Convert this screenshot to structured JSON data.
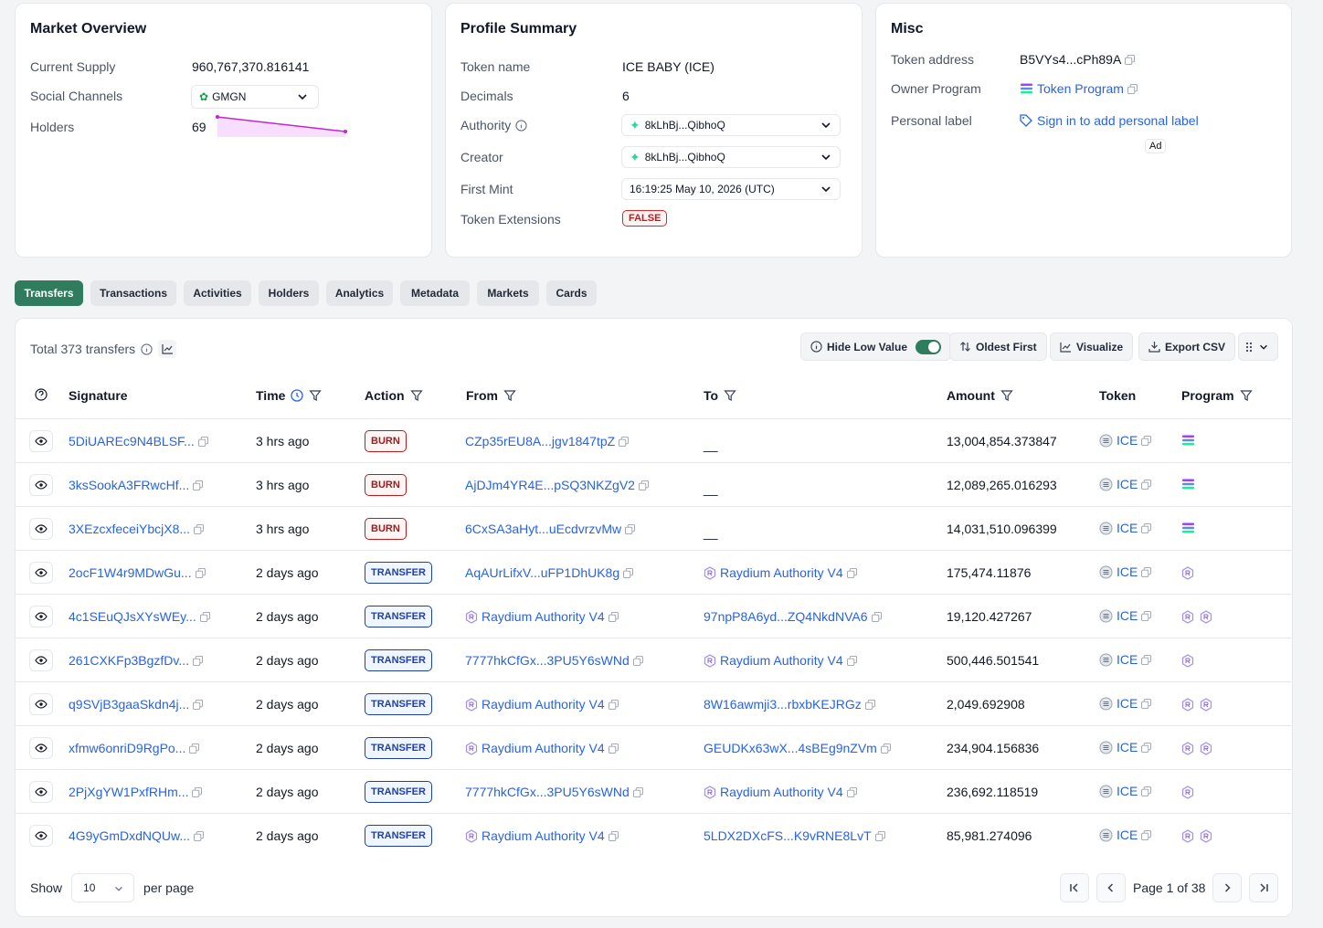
{
  "market": {
    "title": "Market Overview",
    "supply_label": "Current Supply",
    "supply_value": "960,767,370.816141",
    "social_label": "Social Channels",
    "social_value": "GMGN",
    "holders_label": "Holders",
    "holders_value": "69"
  },
  "profile": {
    "title": "Profile Summary",
    "token_name_label": "Token name",
    "token_name_value": "ICE BABY (ICE)",
    "decimals_label": "Decimals",
    "decimals_value": "6",
    "authority_label": "Authority",
    "authority_value": "8kLhBj...QibhoQ",
    "creator_label": "Creator",
    "creator_value": "8kLhBj...QibhoQ",
    "first_mint_label": "First Mint",
    "first_mint_value": "16:19:25 May 10, 2026 (UTC)",
    "extensions_label": "Token Extensions",
    "extensions_value": "FALSE"
  },
  "misc": {
    "title": "Misc",
    "address_label": "Token address",
    "address_value": "B5VYs4...cPh89A",
    "owner_label": "Owner Program",
    "owner_value": "Token Program",
    "personal_label": "Personal label",
    "personal_value": "Sign in to add personal label",
    "ad": "Ad"
  },
  "tabs": [
    "Transfers",
    "Transactions",
    "Activities",
    "Holders",
    "Analytics",
    "Metadata",
    "Markets",
    "Cards"
  ],
  "toolbar": {
    "total": "Total 373 transfers",
    "hide_low": "Hide Low Value",
    "oldest": "Oldest First",
    "visualize": "Visualize",
    "export": "Export CSV"
  },
  "columns": {
    "signature": "Signature",
    "time": "Time",
    "action": "Action",
    "from": "From",
    "to": "To",
    "amount": "Amount",
    "token": "Token",
    "program": "Program"
  },
  "rows": [
    {
      "sig": "5DiUAREc9N4BLSF...",
      "time": "3 hrs ago",
      "action": "BURN",
      "from": "CZp35rEU8A...jgv1847tpZ",
      "to": "__",
      "amount": "13,004,854.373847",
      "token": "ICE"
    },
    {
      "sig": "3ksSookA3FRwcHf...",
      "time": "3 hrs ago",
      "action": "BURN",
      "from": "AjDJm4YR4E...pSQ3NKZgV2",
      "to": "__",
      "amount": "12,089,265.016293",
      "token": "ICE"
    },
    {
      "sig": "3XEzcxfeceiYbcjX8...",
      "time": "3 hrs ago",
      "action": "BURN",
      "from": "6CxSA3aHyt...uEcdvrzvMw",
      "to": "__",
      "amount": "14,031,510.096399",
      "token": "ICE"
    },
    {
      "sig": "2ocF1W4r9MDwGu...",
      "time": "2 days ago",
      "action": "TRANSFER",
      "from": "AqAUrLifxV...uFP1DhUK8g",
      "to": "Raydium Authority V4",
      "amount": "175,474.11876",
      "token": "ICE"
    },
    {
      "sig": "4c1SEuQJsXYsWEy...",
      "time": "2 days ago",
      "action": "TRANSFER",
      "from": "Raydium Authority V4",
      "to": "97npP8A6yd...ZQ4NkdNVA6",
      "amount": "19,120.427267",
      "token": "ICE"
    },
    {
      "sig": "261CXKFp3BgzfDv...",
      "time": "2 days ago",
      "action": "TRANSFER",
      "from": "7777hkCfGx...3PU5Y6sWNd",
      "to": "Raydium Authority V4",
      "amount": "500,446.501541",
      "token": "ICE"
    },
    {
      "sig": "q9SVjB3gaaSkdn4j...",
      "time": "2 days ago",
      "action": "TRANSFER",
      "from": "Raydium Authority V4",
      "to": "8W16awmji3...rbxbKEJRGz",
      "amount": "2,049.692908",
      "token": "ICE"
    },
    {
      "sig": "xfmw6onriD9RgPo...",
      "time": "2 days ago",
      "action": "TRANSFER",
      "from": "Raydium Authority V4",
      "to": "GEUDKx63wX...4sBEg9nZVm",
      "amount": "234,904.156836",
      "token": "ICE"
    },
    {
      "sig": "2PjXgYW1PxfRHm...",
      "time": "2 days ago",
      "action": "TRANSFER",
      "from": "7777hkCfGx...3PU5Y6sWNd",
      "to": "Raydium Authority V4",
      "amount": "236,692.118519",
      "token": "ICE"
    },
    {
      "sig": "4G9yGmDxdNQUw...",
      "time": "2 days ago",
      "action": "TRANSFER",
      "from": "Raydium Authority V4",
      "to": "5LDX2DXcFS...K9vRNE8LvT",
      "amount": "85,981.274096",
      "token": "ICE"
    }
  ],
  "footer": {
    "show": "Show",
    "per_page_value": "10",
    "per_page": "per page",
    "page": "Page 1 of 38"
  }
}
